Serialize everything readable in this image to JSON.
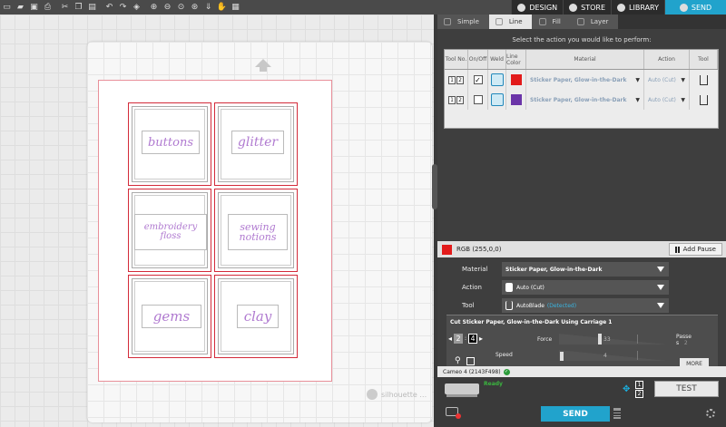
{
  "toolbar": {
    "icons": [
      "new-file-icon",
      "open-file-icon",
      "save-icon",
      "print-icon",
      "cut-icon",
      "copy-icon",
      "paste-icon",
      "undo-icon",
      "redo-icon",
      "group-icon",
      "zoom-in-icon",
      "zoom-out-icon",
      "zoom-box-icon",
      "zoom-fit-icon",
      "pan-icon",
      "drag-icon",
      "grid-icon"
    ]
  },
  "nav": {
    "design": "DESIGN",
    "store": "STORE",
    "library": "LIBRARY",
    "send": "SEND",
    "active_color": "#21a3cc"
  },
  "canvas": {
    "cells": [
      "buttons",
      "glitter",
      "embroidery floss",
      "sewing notions",
      "gems",
      "clay"
    ],
    "cell_lines": [
      [
        "buttons"
      ],
      [
        "glitter"
      ],
      [
        "embroidery",
        "floss"
      ],
      [
        "sewing",
        "notions"
      ],
      [
        "gems"
      ],
      [
        "clay"
      ]
    ],
    "watermark": "silhouette",
    "label_color": "#b07ad0",
    "cut_color": "#d32b3a"
  },
  "panel": {
    "tabs": [
      "Simple",
      "Line",
      "Fill",
      "Layer"
    ],
    "active_tab": "Line",
    "instruction": "Select the action you would like to perform:",
    "headers": [
      "Tool No.",
      "On/Off",
      "Weld",
      "Line Color",
      "Material",
      "Action",
      "Tool"
    ],
    "rows": [
      {
        "tool_no": [
          "1",
          "2"
        ],
        "on": true,
        "color": "#e21b1b",
        "material": "Sticker Paper, Glow-in-the-Dark",
        "action": "Auto (Cut)"
      },
      {
        "tool_no": [
          "1",
          "2"
        ],
        "on": false,
        "color": "#6b35a8",
        "material": "Sticker Paper, Glow-in-the-Dark",
        "action": "Auto (Cut)"
      }
    ],
    "rgb_label": "RGB (255,0,0)",
    "add_pause": "Add Pause",
    "settings": {
      "material_label": "Material",
      "material_value": "Sticker Paper, Glow-in-the-Dark",
      "action_label": "Action",
      "action_value": "Auto (Cut)",
      "tool_label": "Tool",
      "tool_value": "AutoBlade",
      "tool_detected": "(Detected)"
    },
    "cut": {
      "title": "Cut Sticker Paper, Glow-in-the-Dark Using Carriage 1",
      "blade_values": [
        "2",
        "4"
      ],
      "force_label": "Force",
      "force_value": "33",
      "speed_label": "Speed",
      "speed_value": "4",
      "passes_label": "Passe",
      "passes_suffix": "s",
      "passes_value": "2",
      "more": "MORE"
    },
    "machine": "Cameo 4 (2143F498)",
    "status": "Ready",
    "carriages": [
      "1",
      "2"
    ],
    "test": "TEST",
    "send": "SEND"
  }
}
